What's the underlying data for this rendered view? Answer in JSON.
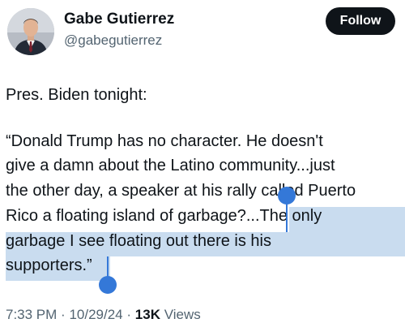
{
  "author": {
    "name": "Gabe Gutierrez",
    "handle": "@gabegutierrez"
  },
  "follow_label": "Follow",
  "intro": "Pres. Biden tonight:",
  "quote_lines": [
    "“Donald Trump has no character. He doesn't",
    "give a damn about the Latino community...just",
    "the other day, a speaker at his rally called Puerto",
    "Rico a floating island of garbage?...The only",
    "garbage I see floating out there is his",
    "supporters.”"
  ],
  "meta": {
    "time": "7:33 PM",
    "date": "10/29/24",
    "separator": "·",
    "views_count": "13K",
    "views_label": "Views"
  },
  "colors": {
    "selection": "#c9dcef",
    "selection_handle": "#3478d8",
    "follow_bg": "#0f1419",
    "secondary_text": "#536471"
  },
  "selection": {
    "start_text": "The only",
    "end_text": "supporters.”"
  }
}
